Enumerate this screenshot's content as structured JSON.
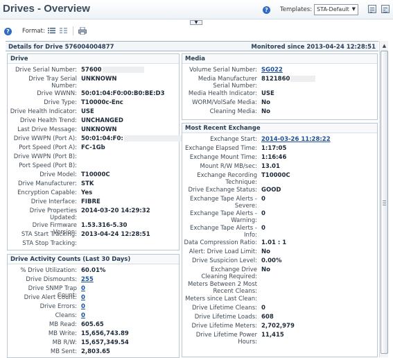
{
  "header": {
    "title": "Drives - Overview",
    "templates_label": "Templates:",
    "templates_value": "STA-Default"
  },
  "toolbar": {
    "format_label": "Format:"
  },
  "details": {
    "title": "Details for Drive 576004004877",
    "monitored": "Monitored since 2013-04-24 12:28:51"
  },
  "drive": {
    "title": "Drive",
    "rows": [
      {
        "label": "Drive Serial Number:",
        "value": "57600"
      },
      {
        "label": "Drive Tray Serial Number:",
        "value": "UNKNOWN"
      },
      {
        "label": "Drive WWNN:",
        "value": "50:01:04:F0:00:B0:BE:D3"
      },
      {
        "label": "Drive Type:",
        "value": "T10000c-Enc"
      },
      {
        "label": "Drive Health Indicator:",
        "value": "USE"
      },
      {
        "label": "Drive Health Trend:",
        "value": "UNCHANGED"
      },
      {
        "label": "Last Drive Message:",
        "value": "UNKNOWN"
      },
      {
        "label": "Drive WWPN (Port A):",
        "value": "50:01:04:F0:"
      },
      {
        "label": "Port Speed (Port A):",
        "value": "FC-1Gb"
      },
      {
        "label": "Drive WWPN (Port B):",
        "value": ""
      },
      {
        "label": "Port Speed (Port B):",
        "value": ""
      },
      {
        "label": "Drive Model:",
        "value": "T10000C"
      },
      {
        "label": "Drive Manufacturer:",
        "value": "STK"
      },
      {
        "label": "Encryption Capable:",
        "value": "Yes"
      },
      {
        "label": "Drive Interface:",
        "value": "FIBRE"
      },
      {
        "label": "Drive Properties Updated:",
        "value": "2014-03-20 14:29:32"
      },
      {
        "label": "Drive Firmware Version:",
        "value": "1.53.316-5.30"
      },
      {
        "label": "STA Start Tracking:",
        "value": "2013-04-24 12:28:51"
      },
      {
        "label": "STA Stop Tracking:",
        "value": ""
      }
    ]
  },
  "activity": {
    "title": "Drive Activity Counts (Last 30 Days)",
    "rows": [
      {
        "label": "% Drive Utilization:",
        "value": "60.01%"
      },
      {
        "label": "Drive Dismounts:",
        "value": "255"
      },
      {
        "label": "Drive SNMP Trap Count:",
        "value": "0"
      },
      {
        "label": "Drive Alert Count:",
        "value": "0"
      },
      {
        "label": "Drive Errors:",
        "value": "0"
      },
      {
        "label": "Cleans:",
        "value": "0"
      },
      {
        "label": "MB Read:",
        "value": "605.65"
      },
      {
        "label": "MB Write:",
        "value": "15,656,743.89"
      },
      {
        "label": "MB R/W:",
        "value": "15,657,349.54"
      },
      {
        "label": "MB Sent:",
        "value": "2,803.65"
      }
    ]
  },
  "media": {
    "title": "Media",
    "rows": [
      {
        "label": "Volume Serial Number:",
        "value": "SG022"
      },
      {
        "label": "Media Manufacturer Serial Number:",
        "value": "8121860"
      },
      {
        "label": "Media Health Indicator:",
        "value": "USE"
      },
      {
        "label": "WORM/VolSafe Media:",
        "value": "No"
      },
      {
        "label": "Cleaning Media:",
        "value": "No"
      }
    ]
  },
  "exchange": {
    "title": "Most Recent Exchange",
    "rows": [
      {
        "label": "Exchange Start:",
        "value": "2014-03-26 11:28:22"
      },
      {
        "label": "Exchange Elapsed Time:",
        "value": "1:17:05"
      },
      {
        "label": "Exchange Mount Time:",
        "value": "1:16:46"
      },
      {
        "label": "Mount R/W MB/sec:",
        "value": "13.01"
      },
      {
        "label": "Exchange Recording Technique:",
        "value": "T10000C"
      },
      {
        "label": "Drive Exchange Status:",
        "value": "GOOD"
      },
      {
        "label": "Exchange Tape Alerts - Severe:",
        "value": "0"
      },
      {
        "label": "Exchange Tape Alerts - Warning:",
        "value": "0"
      },
      {
        "label": "Exchange Tape Alerts - Info:",
        "value": "0"
      },
      {
        "label": "Data Compression Ratio:",
        "value": "1.01 : 1"
      },
      {
        "label": "Alert: Drive Load Limit:",
        "value": "No"
      },
      {
        "label": "Drive Suspicion Level:",
        "value": "0.00%"
      },
      {
        "label": "Exchange Drive Cleaning Required:",
        "value": "No"
      },
      {
        "label": "Meters Between 2 Most Recent Cleans:",
        "value": ""
      },
      {
        "label": "Meters since Last Clean:",
        "value": ""
      },
      {
        "label": "Drive Lifetime Cleans:",
        "value": "0"
      },
      {
        "label": "Drive Lifetime Loads:",
        "value": "608"
      },
      {
        "label": "Drive Lifetime Meters:",
        "value": "2,702,979"
      },
      {
        "label": "Drive Lifetime Power Hours:",
        "value": "11,415"
      }
    ]
  }
}
